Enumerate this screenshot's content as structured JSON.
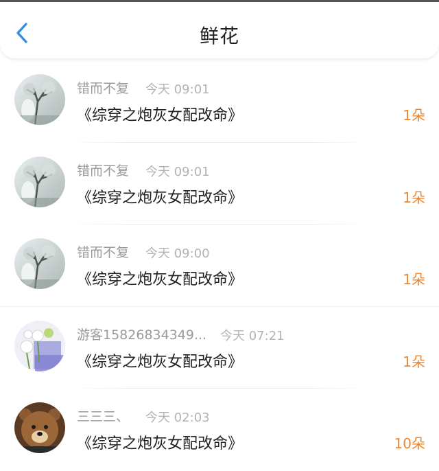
{
  "header": {
    "title": "鲜花",
    "back_icon": "chevron-left-icon"
  },
  "colors": {
    "accent": "#2b8be6",
    "count": "#f0842d"
  },
  "records": [
    {
      "user": "错而不复",
      "time": "今天 09:01",
      "book": "《综穿之炮灰女配改命》",
      "count": "1朵",
      "avatar": "avatar-tree"
    },
    {
      "user": "错而不复",
      "time": "今天 09:01",
      "book": "《综穿之炮灰女配改命》",
      "count": "1朵",
      "avatar": "avatar-tree"
    },
    {
      "user": "错而不复",
      "time": "今天 09:00",
      "book": "《综穿之炮灰女配改命》",
      "count": "1朵",
      "avatar": "avatar-tree"
    },
    {
      "user": "游客15826834349...",
      "time": "今天 07:21",
      "book": "《综穿之炮灰女配改命》",
      "count": "1朵",
      "avatar": "avatar-flowers"
    },
    {
      "user": "三三三、",
      "time": "今天 02:03",
      "book": "《综穿之炮灰女配改命》",
      "count": "10朵",
      "avatar": "avatar-bear"
    }
  ]
}
